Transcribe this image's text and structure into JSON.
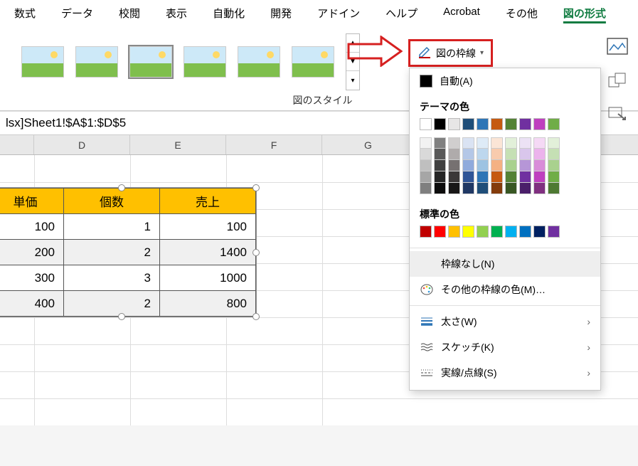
{
  "tabs": [
    "数式",
    "データ",
    "校閲",
    "表示",
    "自動化",
    "開発",
    "アドイン",
    "ヘルプ",
    "Acrobat",
    "その他",
    "図の形式"
  ],
  "active_tab_index": 10,
  "gallery_label": "図のスタイル",
  "outline_button": "図の枠線",
  "formula": "lsx]Sheet1!$A$1:$D$5",
  "columns": [
    "D",
    "E",
    "F",
    "G"
  ],
  "table": {
    "headers": [
      "単価",
      "個数",
      "売上"
    ],
    "rows": [
      [
        "100",
        "1",
        "100"
      ],
      [
        "200",
        "2",
        "1400"
      ],
      [
        "300",
        "3",
        "1000"
      ],
      [
        "400",
        "2",
        "800"
      ]
    ]
  },
  "dropdown": {
    "auto": "自動(A)",
    "theme_title": "テーマの色",
    "standard_title": "標準の色",
    "no_outline": "枠線なし(N)",
    "more_colors": "その他の枠線の色(M)…",
    "weight": "太さ(W)",
    "sketch": "スケッチ(K)",
    "dashes": "実線/点線(S)"
  },
  "colors": {
    "theme_row": [
      "#ffffff",
      "#000000",
      "#e7e6e6",
      "#1f4e79",
      "#2e75b6",
      "#c55a11",
      "#548235",
      "#7030a0",
      "#bf40bf",
      "#70ad47"
    ],
    "shades": [
      [
        "#f2f2f2",
        "#d9d9d9",
        "#bfbfbf",
        "#a6a6a6",
        "#7f7f7f"
      ],
      [
        "#808080",
        "#595959",
        "#404040",
        "#262626",
        "#0d0d0d"
      ],
      [
        "#d0cece",
        "#afabab",
        "#767171",
        "#3b3838",
        "#181717"
      ],
      [
        "#dae3f3",
        "#b4c7e7",
        "#8faadc",
        "#2f5597",
        "#203864"
      ],
      [
        "#deebf7",
        "#bdd7ee",
        "#9dc3e2",
        "#2e75b6",
        "#1f4e79"
      ],
      [
        "#fbe5d6",
        "#f8cbad",
        "#f4b183",
        "#c55a11",
        "#843c0c"
      ],
      [
        "#e2f0d9",
        "#c5e0b4",
        "#a9d18e",
        "#548235",
        "#385723"
      ],
      [
        "#ece2f5",
        "#d9c6ec",
        "#b696d7",
        "#7030a0",
        "#4a1f6a"
      ],
      [
        "#f5d9f5",
        "#ecb3ec",
        "#d98cd9",
        "#bf40bf",
        "#803080"
      ],
      [
        "#e2f0d9",
        "#c5e0b4",
        "#a9d18e",
        "#70ad47",
        "#4e7932"
      ]
    ],
    "standard": [
      "#c00000",
      "#ff0000",
      "#ffc000",
      "#ffff00",
      "#92d050",
      "#00b050",
      "#00b0f0",
      "#0070c0",
      "#002060",
      "#7030a0"
    ]
  }
}
